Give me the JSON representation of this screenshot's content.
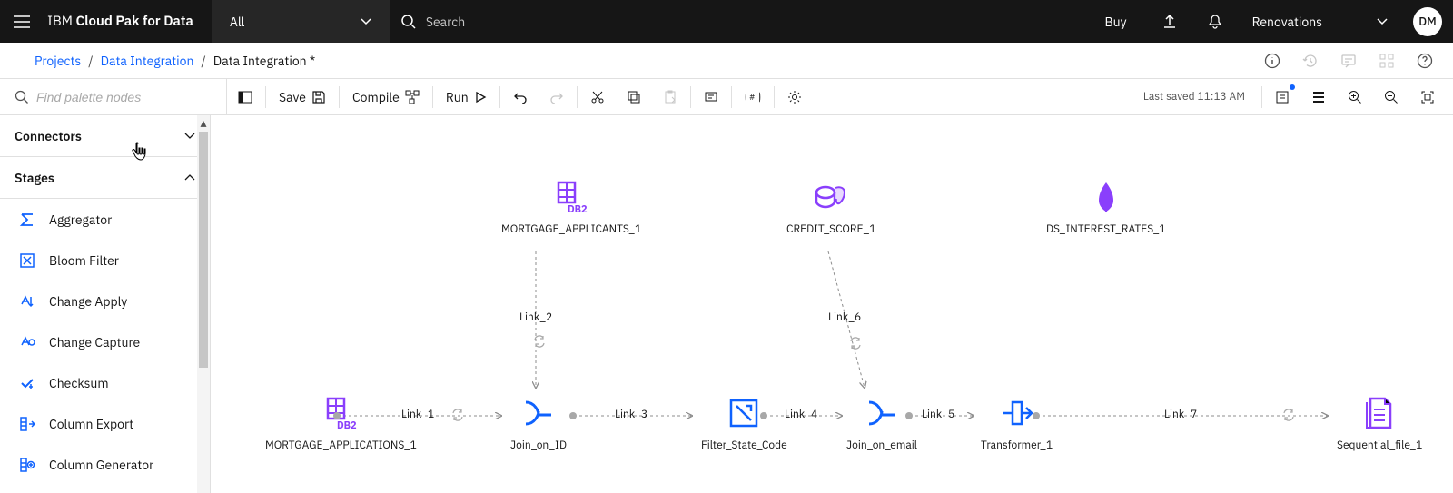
{
  "header": {
    "brand_light": "IBM ",
    "brand_bold": "Cloud Pak for Data",
    "dropdown_label": "All",
    "search_placeholder": "Search",
    "buy_label": "Buy",
    "workspace_label": "Renovations",
    "avatar_initials": "DM"
  },
  "breadcrumb": {
    "items": [
      {
        "label": "Projects",
        "link": true
      },
      {
        "label": "Data Integration",
        "link": true
      },
      {
        "label": "Data Integration *",
        "link": false
      }
    ]
  },
  "toolbar": {
    "palette_placeholder": "Find palette nodes",
    "save_label": "Save",
    "compile_label": "Compile",
    "run_label": "Run",
    "last_saved": "Last saved 11:13 AM"
  },
  "palette": {
    "sections": {
      "connectors_label": "Connectors",
      "stages_label": "Stages"
    },
    "stages": [
      "Aggregator",
      "Bloom Filter",
      "Change Apply",
      "Change Capture",
      "Checksum",
      "Column Export",
      "Column Generator"
    ]
  },
  "canvas": {
    "nodes": {
      "mortgage_applicants": "MORTGAGE_APPLICANTS_1",
      "credit_score": "CREDIT_SCORE_1",
      "ds_interest_rates": "DS_INTEREST_RATES_1",
      "mortgage_applications": "MORTGAGE_APPLICATIONS_1",
      "join_on_id": "Join_on_ID",
      "filter_state_code": "Filter_State_Code",
      "join_on_email": "Join_on_email",
      "transformer": "Transformer_1",
      "sequential_file": "Sequential_file_1"
    },
    "links": {
      "link_1": "Link_1",
      "link_2": "Link_2",
      "link_3": "Link_3",
      "link_4": "Link_4",
      "link_5": "Link_5",
      "link_6": "Link_6",
      "link_7": "Link_7"
    }
  }
}
